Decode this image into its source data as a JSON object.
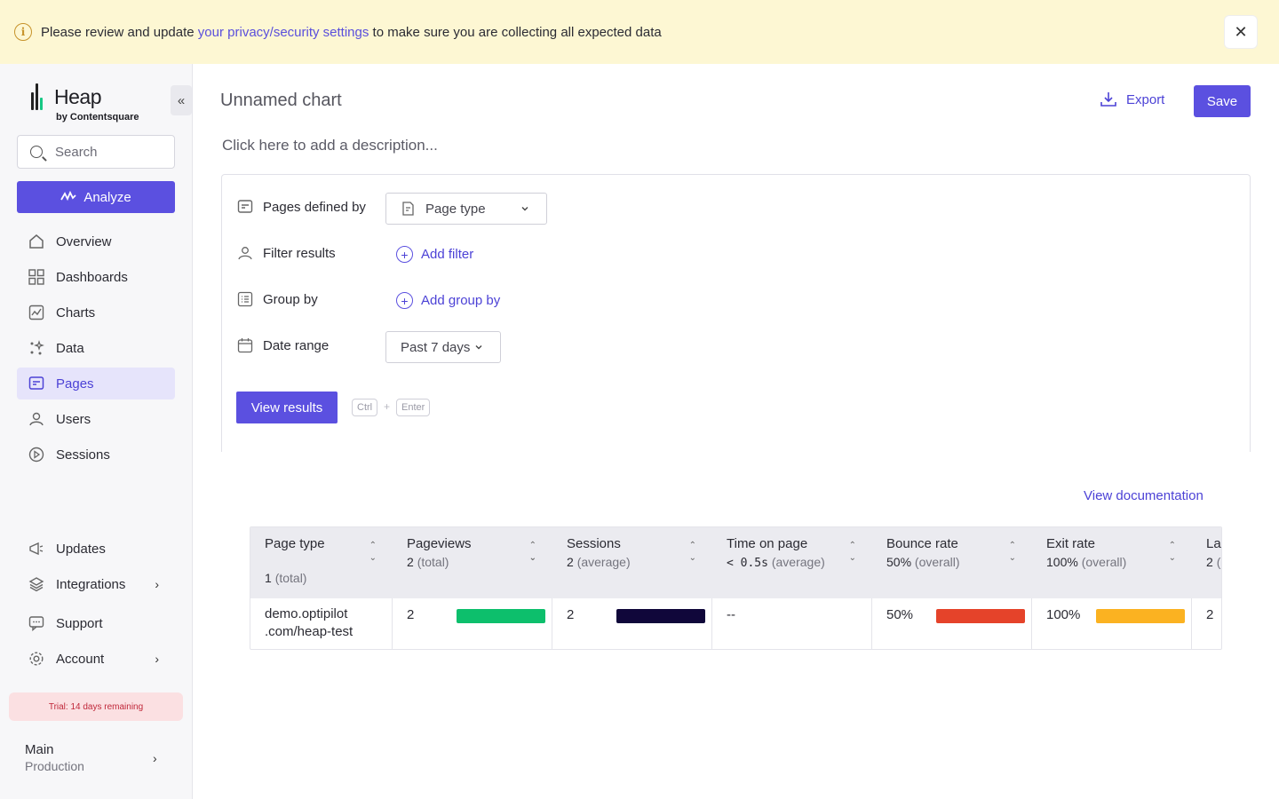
{
  "banner": {
    "prefix": "Please review and update ",
    "link": "your privacy/security settings",
    "suffix": " to make sure you are collecting all expected data",
    "close": "✕"
  },
  "sidebar": {
    "logo_word": "Heap",
    "logo_by": "by Contentsquare",
    "collapse": "«",
    "search_placeholder": "Search",
    "analyze_label": "Analyze",
    "items": [
      {
        "label": "Overview",
        "icon": "home-icon"
      },
      {
        "label": "Dashboards",
        "icon": "grid-icon"
      },
      {
        "label": "Charts",
        "icon": "chart-icon"
      },
      {
        "label": "Data",
        "icon": "sparkle-icon"
      },
      {
        "label": "Pages",
        "icon": "pages-icon",
        "active": true
      },
      {
        "label": "Users",
        "icon": "users-icon"
      },
      {
        "label": "Sessions",
        "icon": "play-icon"
      }
    ],
    "bottom_items": [
      {
        "label": "Updates",
        "icon": "megaphone-icon"
      },
      {
        "label": "Integrations",
        "icon": "layers-icon",
        "chevron": "›"
      },
      {
        "label": "Support",
        "icon": "chat-icon"
      },
      {
        "label": "Account",
        "icon": "gear-icon",
        "chevron": "›"
      }
    ],
    "trial": "Trial: 14 days remaining",
    "env_name": "Main",
    "env_sub": "Production",
    "env_chevron": "›"
  },
  "header": {
    "title": "Unnamed chart",
    "description_placeholder": "Click here to add a description...",
    "export_label": "Export",
    "save_label": "Save"
  },
  "query": {
    "pages_defined_label": "Pages defined by",
    "pages_defined_value": "Page type",
    "filter_label": "Filter results",
    "add_filter": "Add filter",
    "group_label": "Group by",
    "add_group": "Add group by",
    "date_label": "Date range",
    "date_value": "Past 7 days",
    "view_results": "View results",
    "kbd_ctrl": "Ctrl",
    "kbd_plus": "+",
    "kbd_enter": "Enter"
  },
  "view_documentation": "View documentation",
  "table": {
    "columns": [
      {
        "name": "Page type",
        "value": "1",
        "qualifier": "(total)"
      },
      {
        "name": "Pageviews",
        "value": "2",
        "qualifier": "(total)"
      },
      {
        "name": "Sessions",
        "value": "2",
        "qualifier": "(average)"
      },
      {
        "name": "Time on page",
        "value": "< 0.5s",
        "qualifier": "(average)"
      },
      {
        "name": "Bounce rate",
        "value": "50%",
        "qualifier": "(overall)"
      },
      {
        "name": "Exit rate",
        "value": "100%",
        "qualifier": "(overall)"
      },
      {
        "name": "La",
        "value": "2",
        "qualifier": "("
      }
    ],
    "row": {
      "page_line1": "demo.optipilot",
      "page_line2": ".com/heap-test",
      "pageviews": "2",
      "sessions": "2",
      "time_on_page": "--",
      "bounce_rate": "50%",
      "exit_rate": "100%",
      "last": "2"
    },
    "bar_colors": {
      "pageviews": "#0dbf6c",
      "sessions": "#10073a",
      "bounce_rate": "#e5432a",
      "exit_rate": "#fbb221"
    },
    "bar_fill": 1.0
  }
}
